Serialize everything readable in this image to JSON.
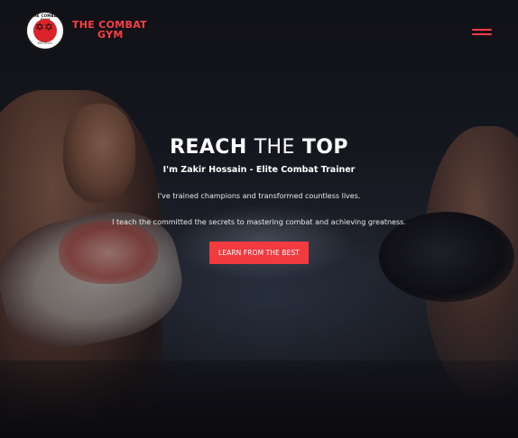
{
  "header": {
    "logo": {
      "ring_text": "THE COMBAT GYM",
      "glyph": "✡✡",
      "est": "EST.2021"
    },
    "brand_line1": "THE COMBAT",
    "brand_line2": "GYM",
    "menu_icon": "hamburger-icon"
  },
  "hero": {
    "headline_part1": "REACH",
    "headline_part2": "THE",
    "headline_part3": "TOP",
    "subtitle": "I'm Zakir Hossain - Elite Combat Trainer",
    "paragraph1": "I've trained champions and transformed countless lives.",
    "paragraph2": "I teach the committed the secrets to mastering combat and achieving greatness.",
    "cta_label": "LEARN FROM THE BEST"
  },
  "colors": {
    "accent": "#ff3d45",
    "button": "#f23a41",
    "text": "#ffffff"
  }
}
